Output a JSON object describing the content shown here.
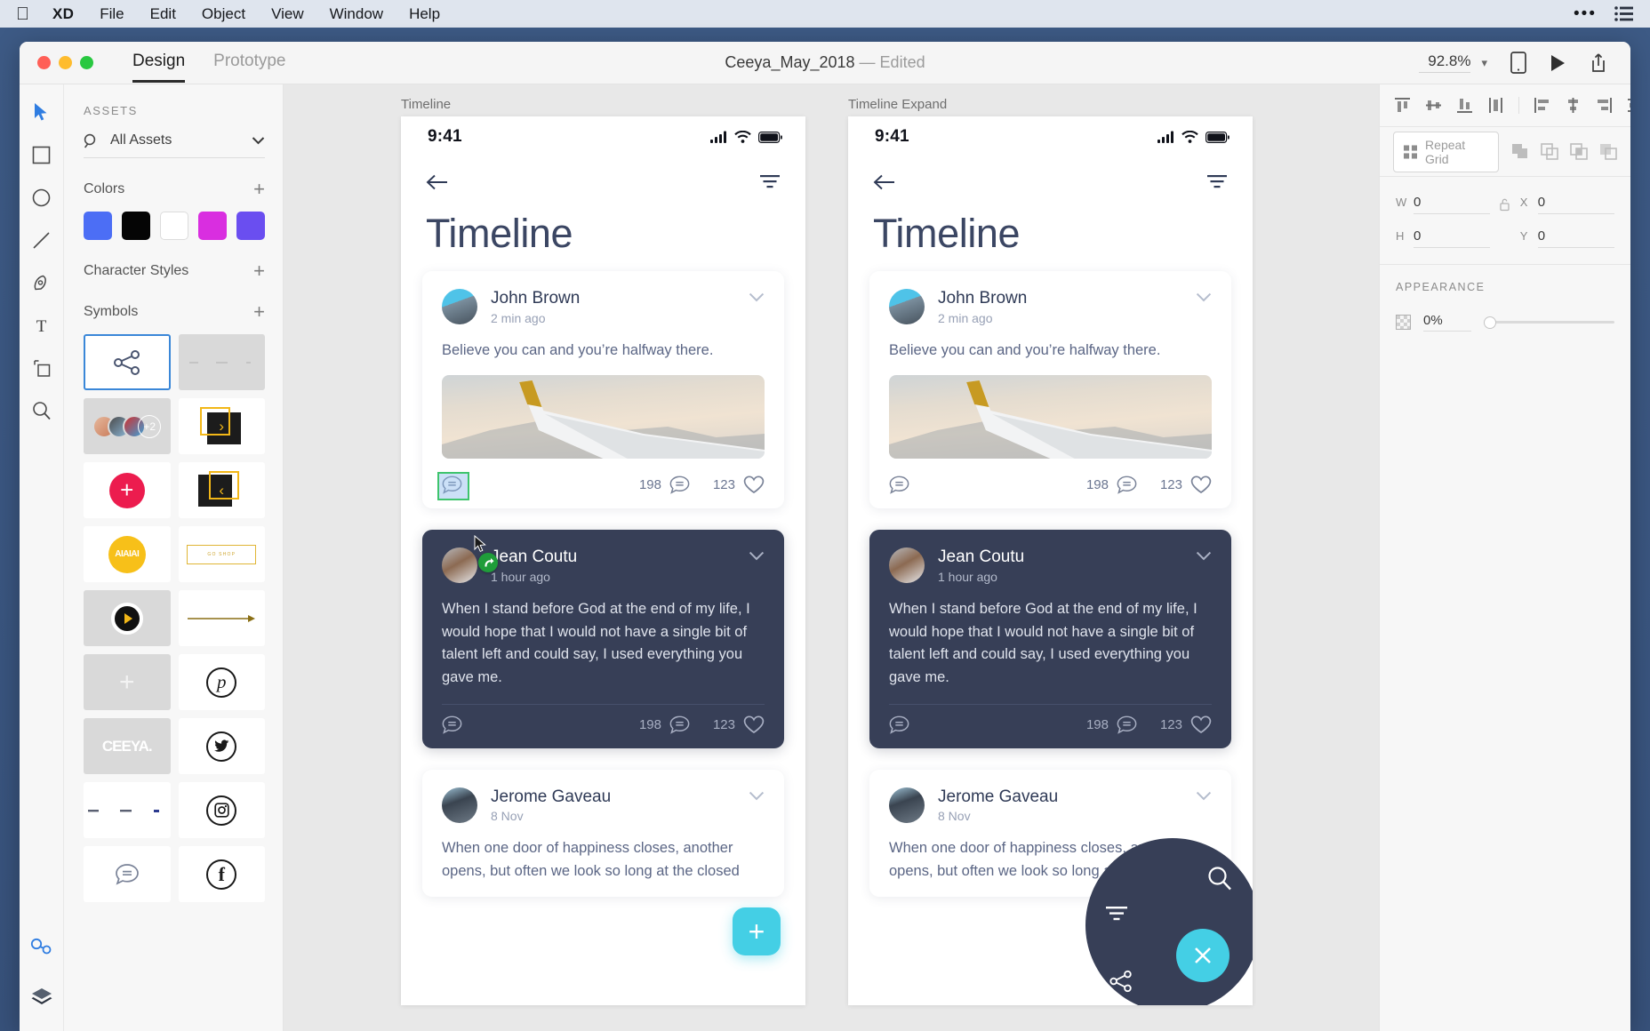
{
  "menubar": {
    "apple_icon": "apple-icon",
    "items": [
      "XD",
      "File",
      "Edit",
      "Object",
      "View",
      "Window",
      "Help"
    ],
    "right_icons": [
      "control-center-dots-icon",
      "list-icon"
    ]
  },
  "window": {
    "tabs": [
      {
        "label": "Design",
        "active": true
      },
      {
        "label": "Prototype",
        "active": false
      }
    ],
    "doc_title": "Ceeya_May_2018",
    "doc_dash": "—",
    "doc_state": "Edited",
    "zoom": "92.8%",
    "zoom_chevron": "chevron-down-icon",
    "right_icons": [
      "device-preview-icon",
      "play-icon",
      "share-icon"
    ]
  },
  "toolbar": {
    "tools": [
      "select-tool-icon",
      "rectangle-tool-icon",
      "ellipse-tool-icon",
      "line-tool-icon",
      "pen-tool-icon",
      "text-tool-icon",
      "artboard-tool-icon",
      "zoom-tool-icon"
    ],
    "bottom": [
      "assets-panel-icon",
      "layers-panel-icon"
    ]
  },
  "assets": {
    "header": "ASSETS",
    "search_label": "All Assets",
    "search_icon": "search-icon",
    "dropdown_icon": "chevron-down-icon",
    "sections": [
      {
        "label": "Colors",
        "add_icon": "plus-icon"
      },
      {
        "label": "Character Styles",
        "add_icon": "plus-icon"
      },
      {
        "label": "Symbols",
        "add_icon": "plus-icon"
      }
    ],
    "colors": [
      "#4c6ef5",
      "#050505",
      "#ffffff",
      "#d92ee0",
      "#6a4ef0"
    ],
    "symbols": [
      {
        "name": "share-symbol",
        "selected": true
      },
      {
        "name": "dots-row-symbol",
        "selected": false
      },
      {
        "name": "avatar-stack-symbol",
        "badge": "+2",
        "selected": false
      },
      {
        "name": "next-arrow-card-symbol",
        "glyph": "›",
        "selected": false
      },
      {
        "name": "add-circle-symbol",
        "glyph": "+",
        "selected": false
      },
      {
        "name": "prev-arrow-card-symbol",
        "glyph": "‹",
        "selected": false
      },
      {
        "name": "aiaiai-logo-symbol",
        "label": "AIAIAI",
        "selected": false
      },
      {
        "name": "outline-button-symbol",
        "label": "GO SHOP",
        "selected": false
      },
      {
        "name": "play-button-symbol",
        "selected": false
      },
      {
        "name": "long-arrow-symbol",
        "selected": false
      },
      {
        "name": "plus-placeholder-symbol",
        "glyph": "+",
        "selected": false
      },
      {
        "name": "pinterest-icon-symbol",
        "glyph": "p",
        "selected": false
      },
      {
        "name": "ceeya-logo-symbol",
        "label": "CEEYA.",
        "selected": false
      },
      {
        "name": "twitter-icon-symbol",
        "selected": false
      },
      {
        "name": "dashes-row-symbol",
        "selected": false
      },
      {
        "name": "instagram-icon-symbol",
        "selected": false
      },
      {
        "name": "chat-bubble-symbol",
        "selected": false
      },
      {
        "name": "facebook-icon-symbol",
        "glyph": "f",
        "selected": false
      }
    ]
  },
  "canvas": {
    "artboards": [
      {
        "label": "Timeline",
        "status": {
          "time": "9:41",
          "icons": [
            "cellular-icon",
            "wifi-icon",
            "battery-icon"
          ]
        },
        "nav": {
          "back_icon": "back-arrow-icon",
          "filter_icon": "filter-icon"
        },
        "title": "Timeline",
        "posts": [
          {
            "author": "John Brown",
            "time": "2 min ago",
            "text": "Believe you can and you’re halfway there.",
            "has_image": true,
            "image_name": "airplane-wing-photo",
            "comments": "198",
            "likes": "123",
            "dark": false,
            "chat_selected": true
          },
          {
            "author": "Jean Coutu",
            "time": "1 hour ago",
            "text": "When I stand before God at the end of my life, I would hope that I would not have a single bit of talent left and could say, I used everything you gave me.",
            "has_image": false,
            "comments": "198",
            "likes": "123",
            "dark": true,
            "chat_selected": false
          },
          {
            "author": "Jerome Gaveau",
            "time": "8 Nov",
            "text": "When one door of happiness closes, another opens, but often we look so long at the closed",
            "has_image": false,
            "comments": "",
            "likes": "",
            "dark": false,
            "chat_selected": false
          }
        ],
        "fab": {
          "icon": "plus-icon",
          "expanded": false
        }
      },
      {
        "label": "Timeline Expand",
        "status": {
          "time": "9:41",
          "icons": [
            "cellular-icon",
            "wifi-icon",
            "battery-icon"
          ]
        },
        "nav": {
          "back_icon": "back-arrow-icon",
          "filter_icon": "filter-icon"
        },
        "title": "Timeline",
        "posts": [
          {
            "author": "John Brown",
            "time": "2 min ago",
            "text": "Believe you can and you’re halfway there.",
            "has_image": true,
            "image_name": "airplane-wing-photo",
            "comments": "198",
            "likes": "123",
            "dark": false,
            "chat_selected": false
          },
          {
            "author": "Jean Coutu",
            "time": "1 hour ago",
            "text": "When I stand before God at the end of my life, I would hope that I would not have a single bit of talent left and could say, I used everything you gave me.",
            "has_image": false,
            "comments": "198",
            "likes": "123",
            "dark": true,
            "chat_selected": false
          },
          {
            "author": "Jerome Gaveau",
            "time": "8 Nov",
            "text": "When one door of happiness closes, another opens, but often we look so long at the closed",
            "has_image": false,
            "comments": "",
            "likes": "",
            "dark": false,
            "chat_selected": false
          }
        ],
        "fab": {
          "icon": "close-icon",
          "expanded": true,
          "menu_icons": [
            "search-icon",
            "filter-icon",
            "share-icon"
          ]
        }
      }
    ],
    "selection": {
      "marker_name": "selected-chat-icon",
      "badge_name": "repeat-grid-badge",
      "cursor_name": "mouse-cursor"
    }
  },
  "properties": {
    "align_icons_group1": [
      "align-top-icon",
      "align-vertical-center-icon",
      "align-bottom-icon",
      "distribute-vertical-icon"
    ],
    "align_icons_group2": [
      "align-left-icon",
      "align-horizontal-center-icon",
      "align-right-icon",
      "distribute-horizontal-icon"
    ],
    "repeat_grid_label": "Repeat Grid",
    "repeat_grid_icon": "grid-icon",
    "boolean_icons": [
      "add-shapes-icon",
      "subtract-shapes-icon",
      "intersect-shapes-icon",
      "exclude-overlap-icon"
    ],
    "dimensions": {
      "w_label": "W",
      "w_value": "0",
      "h_label": "H",
      "h_value": "0",
      "x_label": "X",
      "x_value": "0",
      "y_label": "Y",
      "y_value": "0",
      "lock_icon": "unlock-icon"
    },
    "appearance": {
      "header": "APPEARANCE",
      "opacity_icon": "opacity-checker-icon",
      "opacity_value": "0%"
    }
  }
}
